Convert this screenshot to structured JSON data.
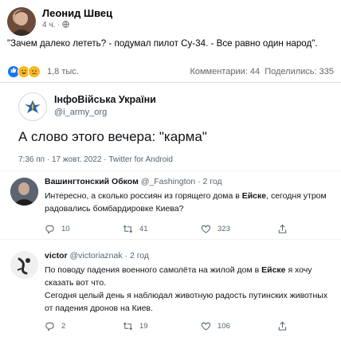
{
  "post": {
    "author": "Леонид Швец",
    "meta": "4 ч. · ",
    "text": "\"Зачем далеко лететь? - подумал пилот Су-34. - Все равно один народ\".",
    "reactions_count": "1,8 тыс.",
    "comments": "Комментарии: 44",
    "shares": "Поделились: 335"
  },
  "tweet": {
    "org_name": "ІнфоВійська України",
    "org_handle": "@i_army_org",
    "text": "А слово этого вечера: \"карма\"",
    "date": "7:36 пп · 17 жовт. 2022 · Twitter for Android"
  },
  "replies": [
    {
      "name": "Вашингтонский Обком",
      "handle": "@_Fashington · 2 год",
      "text_before": "Интересно, а сколько россиян из горящего дома в ",
      "text_bold": "Ейске",
      "text_after": ", сегодня утром радовались бомбардировке Киева?",
      "replies": "10",
      "retweets": "41",
      "likes": "323"
    },
    {
      "name": "victor",
      "handle": "@victoriaznak · 2 год",
      "text_before": "По поводу падения военного самолёта на жилой дом в ",
      "text_bold": "Ейске",
      "text_after": " я хочу сказать вот что.",
      "text_line2": "Сегодня целый день я наблюдал животную радость путинских животных от падения дронов на Киев.",
      "replies": "2",
      "retweets": "19",
      "likes": "106"
    }
  ],
  "colors": {
    "twitter_text": "#0f1419",
    "twitter_muted": "#536471",
    "fb_muted": "#65676b"
  }
}
